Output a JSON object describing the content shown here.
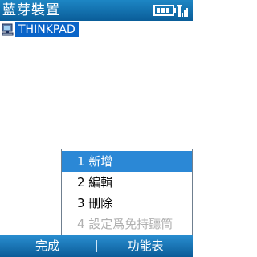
{
  "window": {
    "title": "藍芽裝置"
  },
  "status_icons": {
    "battery": "battery-icon",
    "signal": "signal-icon",
    "accent": "#0a64c8"
  },
  "device_list": {
    "items": [
      {
        "label": "THINKPAD",
        "icon": "computer-icon",
        "selected": true
      }
    ]
  },
  "popup_menu": {
    "items": [
      {
        "label": "1 新增",
        "state": "selected"
      },
      {
        "label": "2 編輯",
        "state": "normal"
      },
      {
        "label": "3 刪除",
        "state": "normal"
      },
      {
        "label": "4 設定爲免持聽筒",
        "state": "disabled"
      }
    ]
  },
  "softkeys": {
    "left_label": "完成",
    "right_label": "功能表"
  }
}
